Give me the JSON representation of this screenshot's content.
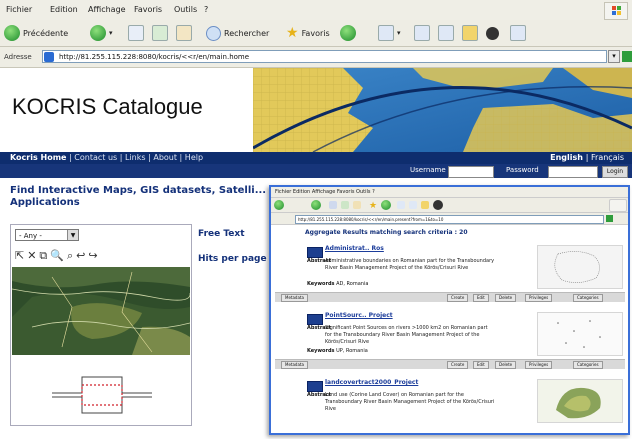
{
  "browser": {
    "menu": [
      "Fichier",
      "Edition",
      "Affichage",
      "Favoris",
      "Outils",
      "?"
    ],
    "toolbar": {
      "back": "Précédente",
      "search": "Rechercher",
      "favorites": "Favoris"
    },
    "address_label": "Adresse",
    "address": "http://81.255.115.228:8080/kocris/<<r/en/main.home"
  },
  "site": {
    "title": "KOCRIS Catalogue",
    "nav": [
      "Kocris Home",
      "Contact us",
      "Links",
      "About",
      "Help"
    ],
    "languages": [
      "English",
      "Français"
    ],
    "login": {
      "username_label": "Username",
      "password_label": "Password",
      "button": "Login"
    },
    "heading": "Find Interactive Maps, GIS datasets, Satelli... Applications",
    "region_select": "- Any -",
    "map_tools": "⇱✕⧉🔍⌕↩↪",
    "free_text_label": "Free Text",
    "hits_label": "Hits per page"
  },
  "popup": {
    "menu": "Fichier  Edition  Affichage  Favoris  Outils  ?",
    "address": "http://81.255.115.228:8080/kocris/<<r/en/main.present?from=1&to=10",
    "results_heading": "Aggregate Results matching search criteria :  20",
    "records": [
      {
        "name": "Administrat.. Ros",
        "abstract_label": "Abstract",
        "abstract": "Administrative boundaries on Romanian part for the Transboundary River Basin Management Project of the Körös/Crisuri Rive",
        "keywords_label": "Keywords",
        "keywords": "AD, Romania",
        "buttons": [
          "Metadata",
          "Create",
          "Edit",
          "Delete",
          "Privileges",
          "Categories"
        ]
      },
      {
        "name": "PointSourc.. Project",
        "abstract_label": "Abstract",
        "abstract": "Significant Point Sources on rivers >1000 km2 on Romanian part for the Transboundary River Basin Management Project of the Körös/Crisuri Rive",
        "keywords_label": "Keywords",
        "keywords": "UP, Romania",
        "buttons": [
          "Metadata",
          "Create",
          "Edit",
          "Delete",
          "Privileges",
          "Categories"
        ]
      },
      {
        "name": "landcovertract2000_Project",
        "abstract_label": "Abstract",
        "abstract": "Land use (Corine Land Cover) on Romanian part for the Transboundary River Basin Management Project of the Körös/Crisuri Rive",
        "keywords_label": "",
        "keywords": "",
        "buttons": []
      }
    ]
  },
  "colors": {
    "navy": "#0e2d6e",
    "heading_blue": "#14317a",
    "popup_border": "#3a6fd8",
    "chrome": "#eeede4"
  }
}
